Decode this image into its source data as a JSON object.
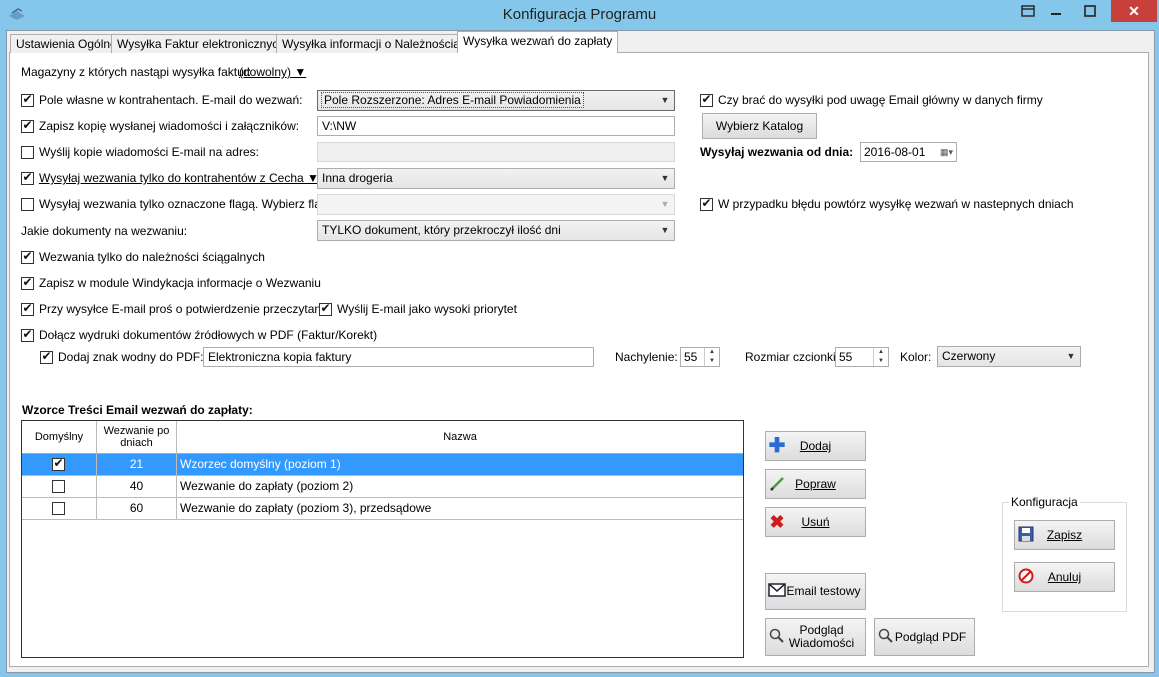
{
  "window": {
    "title": "Konfiguracja Programu",
    "icons": {
      "app": "app-icon",
      "restore": "restore-icon",
      "minimize": "minimize-icon",
      "maximize": "maximize-icon",
      "close": "close-icon"
    }
  },
  "tabs": [
    {
      "label": "Ustawienia Ogólne"
    },
    {
      "label": "Wysyłka Faktur elektronicznych"
    },
    {
      "label": "Wysyłka informacji o Należnościach"
    },
    {
      "label": "Wysyłka wezwań do zapłaty"
    }
  ],
  "active_tab": 3,
  "form": {
    "warehouses_label": "Magazyny z których nastąpi wysyłka faktur:",
    "warehouses_value": "(dowolny) ▼",
    "custom_field_label": "Pole własne w kontrahentach. E-mail do wezwań:",
    "custom_field_value": "Pole Rozszerzone: Adres E-mail Powiadomienia",
    "save_copy_label": "Zapisz kopię wysłanej wiadomości i załączników:",
    "save_copy_path": "V:\\NW",
    "send_copy_label": "Wyślij kopie wiadomości E-mail na adres:",
    "send_copy_value": "",
    "feature_label": "Wysyłaj wezwania tylko do kontrahentów z Cecha ▼",
    "feature_value": "Inna drogeria",
    "flag_label": "Wysyłaj wezwania tylko oznaczone flagą. Wybierz flagę:",
    "flag_value": "",
    "documents_label": "Jakie dokumenty na wezwaniu:",
    "documents_value": "TYLKO dokument, który przekroczył ilość dni",
    "collectible_label": "Wezwania tylko do należności ściągalnych",
    "save_module_label": "Zapisz w module Windykacja informacje o Wezwaniu",
    "confirm_label": "Przy wysyłce E-mail proś o potwierdzenie przeczytania",
    "priority_label": "Wyślij E-mail jako wysoki priorytet",
    "attach_pdf_label": "Dołącz wydruki dokumentów źródłowych w PDF (Faktur/Korekt)",
    "watermark_label": "Dodaj znak wodny do PDF:",
    "watermark_value": "Elektroniczna kopia faktury",
    "tilt_label": "Nachylenie:",
    "tilt_value": "55",
    "fontsize_label": "Rozmiar czcionki:",
    "fontsize_value": "55",
    "color_label": "Kolor:",
    "color_value": "Czerwony",
    "main_email_label": "Czy brać do wysyłki pod uwagę Email główny w danych firmy",
    "choose_dir_button": "Wybierz Katalog",
    "send_from_label": "Wysyłaj wezwania od dnia:",
    "send_from_date": "2016-08-01",
    "retry_label": "W przypadku błędu powtórz wysyłkę wezwań w nastepnych dniach"
  },
  "checks": {
    "custom_field": true,
    "save_copy": true,
    "send_copy": false,
    "feature": true,
    "flag": false,
    "collectible": true,
    "save_module": true,
    "confirm": true,
    "priority": true,
    "attach_pdf": true,
    "watermark": true,
    "main_email": true,
    "retry": true
  },
  "templates": {
    "section_title": "Wzorce Treści Email wezwań do zapłaty:",
    "columns": [
      "Domyślny",
      "Wezwanie po dniach",
      "Nazwa"
    ],
    "rows": [
      {
        "default": true,
        "days": "21",
        "name": "Wzorzec domyślny (poziom 1)",
        "selected": true
      },
      {
        "default": false,
        "days": "40",
        "name": "Wezwanie do zapłaty (poziom 2)",
        "selected": false
      },
      {
        "default": false,
        "days": "60",
        "name": "Wezwanie do zapłaty (poziom 3), przedsądowe",
        "selected": false
      }
    ]
  },
  "buttons": {
    "add": "Dodaj",
    "edit": "Popraw",
    "delete": "Usuń",
    "test_email": "Email testowy",
    "preview_message": "Podgląd Wiadomości",
    "preview_pdf": "Podgląd PDF"
  },
  "config_group": {
    "title": "Konfiguracja",
    "save": "Zapisz",
    "cancel": "Anuluj"
  },
  "colors": {
    "selection": "#3399ff",
    "add_icon": "#2b6cd4",
    "delete_icon": "#d11a1a",
    "cancel_icon": "#d11a1a"
  }
}
